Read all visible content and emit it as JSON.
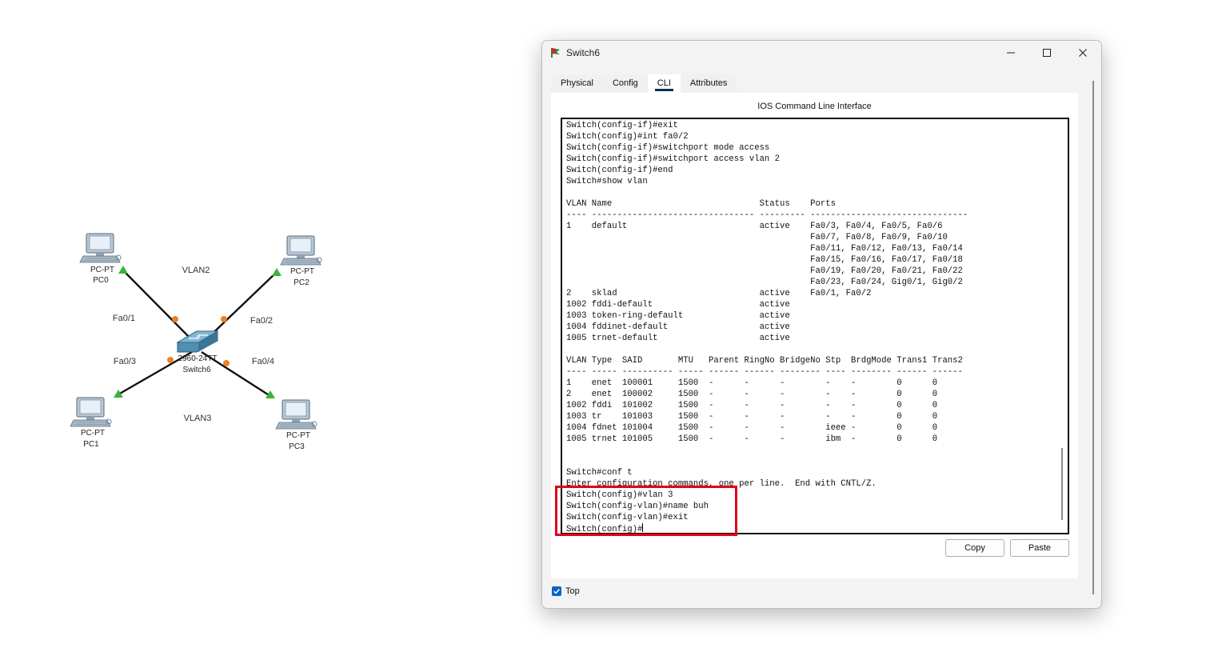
{
  "topology": {
    "devices": [
      {
        "model": "PC-PT",
        "name": "PC0"
      },
      {
        "model": "PC-PT",
        "name": "PC2"
      },
      {
        "model": "PC-PT",
        "name": "PC1"
      },
      {
        "model": "PC-PT",
        "name": "PC3"
      }
    ],
    "switch": {
      "model": "2960-24TT",
      "name": "Switch6"
    },
    "notes": [
      "VLAN2",
      "Fa0/1",
      "Fa0/2",
      "Fa0/3",
      "Fa0/4",
      "VLAN3"
    ],
    "link_colors": {
      "cable": "#111111",
      "port_up": "#f08020",
      "end_up": "#3bb33b"
    }
  },
  "window": {
    "title": "Switch6",
    "tabs": [
      "Physical",
      "Config",
      "CLI",
      "Attributes"
    ],
    "active_tab": "CLI",
    "cli_heading": "IOS Command Line Interface",
    "terminal_text": "Switch(config-if)#exit\nSwitch(config)#int fa0/2\nSwitch(config-if)#switchport mode access\nSwitch(config-if)#switchport access vlan 2\nSwitch(config-if)#end\nSwitch#show vlan\n\nVLAN Name                             Status    Ports\n---- -------------------------------- --------- -------------------------------\n1    default                          active    Fa0/3, Fa0/4, Fa0/5, Fa0/6\n                                                Fa0/7, Fa0/8, Fa0/9, Fa0/10\n                                                Fa0/11, Fa0/12, Fa0/13, Fa0/14\n                                                Fa0/15, Fa0/16, Fa0/17, Fa0/18\n                                                Fa0/19, Fa0/20, Fa0/21, Fa0/22\n                                                Fa0/23, Fa0/24, Gig0/1, Gig0/2\n2    sklad                            active    Fa0/1, Fa0/2\n1002 fddi-default                     active\n1003 token-ring-default               active\n1004 fddinet-default                  active\n1005 trnet-default                    active\n\nVLAN Type  SAID       MTU   Parent RingNo BridgeNo Stp  BrdgMode Trans1 Trans2\n---- ----- ---------- ----- ------ ------ -------- ---- -------- ------ ------\n1    enet  100001     1500  -      -      -        -    -        0      0\n2    enet  100002     1500  -      -      -        -    -        0      0\n1002 fddi  101002     1500  -      -      -        -    -        0      0\n1003 tr    101003     1500  -      -      -        -    -        0      0\n1004 fdnet 101004     1500  -      -      -        ieee -        0      0\n1005 trnet 101005     1500  -      -      -        ibm  -        0      0\n\n\nSwitch#conf t\nEnter configuration commands, one per line.  End with CNTL/Z.\nSwitch(config)#vlan 3\nSwitch(config-vlan)#name buh\nSwitch(config-vlan)#exit\nSwitch(config)#",
    "copy_label": "Copy",
    "paste_label": "Paste",
    "top_checkbox": {
      "label": "Top",
      "checked": true
    }
  },
  "annotation": {
    "highlight_color": "#e0001b"
  }
}
